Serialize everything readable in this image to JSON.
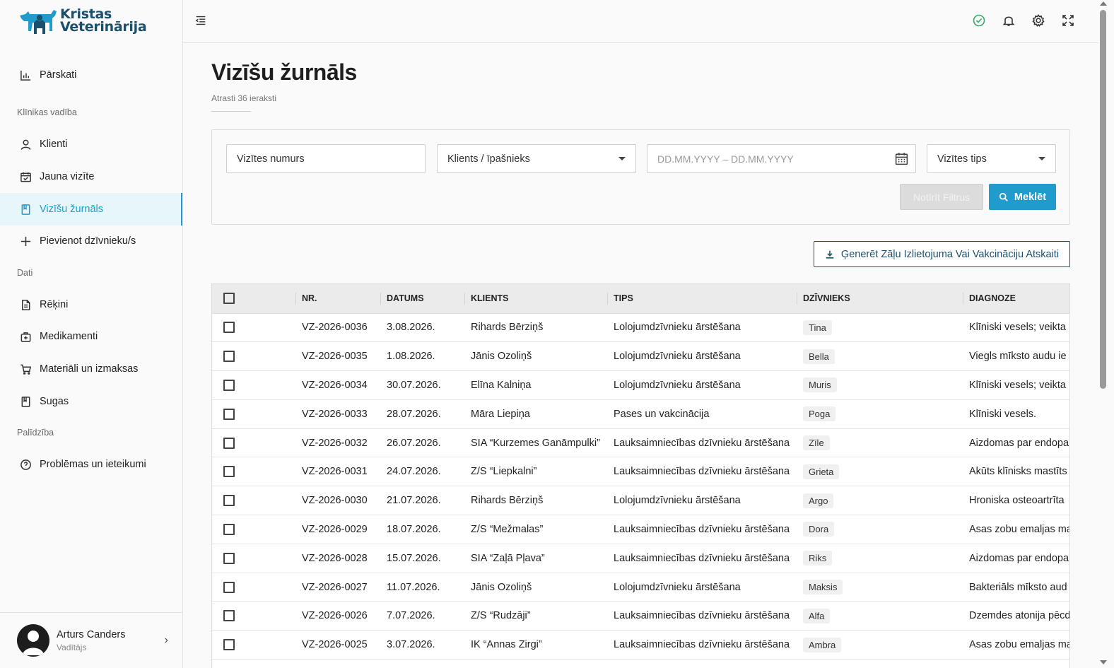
{
  "brand": {
    "line1": "Kristas",
    "line2": "Veterinārija"
  },
  "sidebar": {
    "items": [
      {
        "label": "Pārskati",
        "icon": "bar-chart-icon"
      },
      {
        "label": "Klienti",
        "icon": "user-icon"
      },
      {
        "label": "Jauna vizīte",
        "icon": "calendar-icon"
      },
      {
        "label": "Vizīšu žurnāls",
        "icon": "book-icon",
        "active": true
      },
      {
        "label": "Pievienot dzīvnieku/s",
        "icon": "plus-icon"
      },
      {
        "label": "Rēķini",
        "icon": "document-icon"
      },
      {
        "label": "Medikamenti",
        "icon": "medicine-box-icon"
      },
      {
        "label": "Materiāli un izmaksas",
        "icon": "cart-icon"
      },
      {
        "label": "Sugas",
        "icon": "book-icon"
      },
      {
        "label": "Problēmas un ieteikumi",
        "icon": "help-circle-icon"
      }
    ],
    "sections": [
      "Klīnikas vadība",
      "Dati",
      "Palīdzība"
    ]
  },
  "user": {
    "name": "Arturs Canders",
    "role": "Vadītājs"
  },
  "page": {
    "title": "Vizīšu žurnāls",
    "subtitle": "Atrasti 36 ieraksti"
  },
  "filters": {
    "visit_number": "Vizītes numurs",
    "client": "Klients / īpašnieks",
    "date_range": "DD.MM.YYYY – DD.MM.YYYY",
    "visit_type": "Vizītes tips",
    "clear_label": "Notīrīt Filtrus",
    "search_label": "Meklēt"
  },
  "report_button": "Ģenerēt Zāļu Izlietojuma Vai Vakcināciju Atskaiti",
  "table": {
    "headers": [
      "NR.",
      "DATUMS",
      "KLIENTS",
      "TIPS",
      "DZĪVNIEKS",
      "DIAGNOZE"
    ],
    "rows": [
      [
        "VZ-2026-0036",
        "3.08.2026.",
        "Rihards Bērziņš",
        "Lolojumdzīvnieku ārstēšana",
        "Tina",
        "Klīniski vesels; veikta"
      ],
      [
        "VZ-2026-0035",
        "1.08.2026.",
        "Jānis Ozoliņš",
        "Lolojumdzīvnieku ārstēšana",
        "Bella",
        "Viegls mīksto audu ie"
      ],
      [
        "VZ-2026-0034",
        "30.07.2026.",
        "Elīna Kalniņa",
        "Lolojumdzīvnieku ārstēšana",
        "Muris",
        "Klīniski vesels; veikta"
      ],
      [
        "VZ-2026-0033",
        "28.07.2026.",
        "Māra Liepiņa",
        "Pases un vakcinācija",
        "Poga",
        "Klīniski vesels."
      ],
      [
        "VZ-2026-0032",
        "26.07.2026.",
        "SIA “Kurzemes Ganāmpulki”",
        "Lauksaimniecības dzīvnieku ārstēšana",
        "Zīle",
        "Aizdomas par endopa"
      ],
      [
        "VZ-2026-0031",
        "24.07.2026.",
        "Z/S “Liepkalni”",
        "Lauksaimniecības dzīvnieku ārstēšana",
        "Grieta",
        "Akūts klīnisks mastīts"
      ],
      [
        "VZ-2026-0030",
        "21.07.2026.",
        "Rihards Bērziņš",
        "Lolojumdzīvnieku ārstēšana",
        "Argo",
        "Hroniska osteoartrīta"
      ],
      [
        "VZ-2026-0029",
        "18.07.2026.",
        "Z/S “Mežmalas”",
        "Lauksaimniecības dzīvnieku ārstēšana",
        "Dora",
        "Asas zobu emaljas ma"
      ],
      [
        "VZ-2026-0028",
        "15.07.2026.",
        "SIA “Zaļā Pļava”",
        "Lauksaimniecības dzīvnieku ārstēšana",
        "Riks",
        "Aizdomas par endopa"
      ],
      [
        "VZ-2026-0027",
        "11.07.2026.",
        "Jānis Ozoliņš",
        "Lolojumdzīvnieku ārstēšana",
        "Maksis",
        "Bakteriāls mīksto aud"
      ],
      [
        "VZ-2026-0026",
        "7.07.2026.",
        "Z/S “Rudzāji”",
        "Lauksaimniecības dzīvnieku ārstēšana",
        "Alfa",
        "Dzemdes atonija pēcd"
      ],
      [
        "VZ-2026-0025",
        "3.07.2026.",
        "IK “Annas Zirgi”",
        "Lauksaimniecības dzīvnieku ārstēšana",
        "Ambra",
        "Asas zobu emaljas ma"
      ]
    ]
  },
  "colors": {
    "accent": "#1f9ccc",
    "brand": "#1b4f6e",
    "active_bg": "#e6f6fb"
  }
}
